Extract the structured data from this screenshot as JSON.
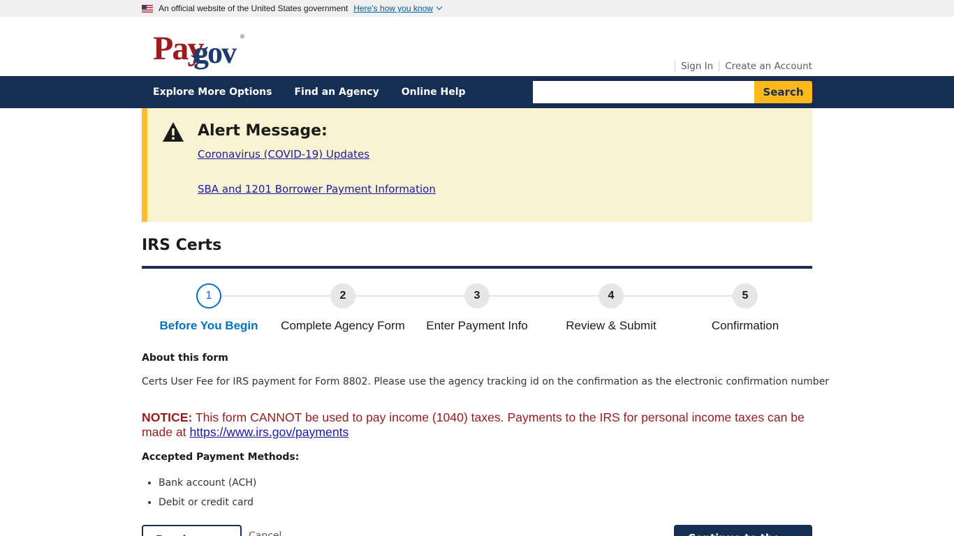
{
  "gov_banner": {
    "text": "An official website of the United States government",
    "link": "Here's how you know",
    "flag_icon": "us-flag-icon"
  },
  "header": {
    "logo": {
      "part1": "Pay",
      "part2": "gov",
      "reg": "®"
    },
    "sign_in": "Sign In",
    "create_account": "Create an Account"
  },
  "nav": {
    "items": [
      {
        "label": "Explore More Options"
      },
      {
        "label": "Find an Agency"
      },
      {
        "label": "Online Help"
      }
    ],
    "search": {
      "value": "",
      "placeholder": "",
      "button": "Search"
    }
  },
  "alert": {
    "icon": "warning-triangle-icon",
    "title": "Alert Message:",
    "links": [
      {
        "label": "Coronavirus (COVID-19) Updates"
      },
      {
        "label": "SBA and 1201 Borrower Payment Information"
      }
    ]
  },
  "page": {
    "title": "IRS Certs"
  },
  "steps": [
    {
      "number": "1",
      "label": "Before You Begin",
      "active": true
    },
    {
      "number": "2",
      "label": "Complete Agency Form",
      "active": false
    },
    {
      "number": "3",
      "label": "Enter Payment Info",
      "active": false
    },
    {
      "number": "4",
      "label": "Review & Submit",
      "active": false
    },
    {
      "number": "5",
      "label": "Confirmation",
      "active": false
    }
  ],
  "about": {
    "heading": "About this form",
    "text": "Certs User Fee for IRS payment for Form 8802. Please use the agency tracking id on the confirmation as the electronic confirmation number"
  },
  "notice": {
    "label": "NOTICE:",
    "text": " This form CANNOT be used to pay income (1040) taxes. Payments to the IRS for personal income taxes can be made at ",
    "link": "https://www.irs.gov/payments"
  },
  "payment_methods": {
    "heading": "Accepted Payment Methods:",
    "items": [
      "Bank account (ACH)",
      "Debit or credit card"
    ]
  },
  "actions": {
    "preview": "Preview Form",
    "cancel": "Cancel",
    "continue": "Continue to the Form"
  },
  "colors": {
    "nav_bg": "#162e51",
    "search_button": "#fdb81e",
    "alert_bg": "#faf3d1",
    "alert_border": "#ffbe2e",
    "step_active": "#0071bc",
    "notice_red": "#981b1e"
  }
}
